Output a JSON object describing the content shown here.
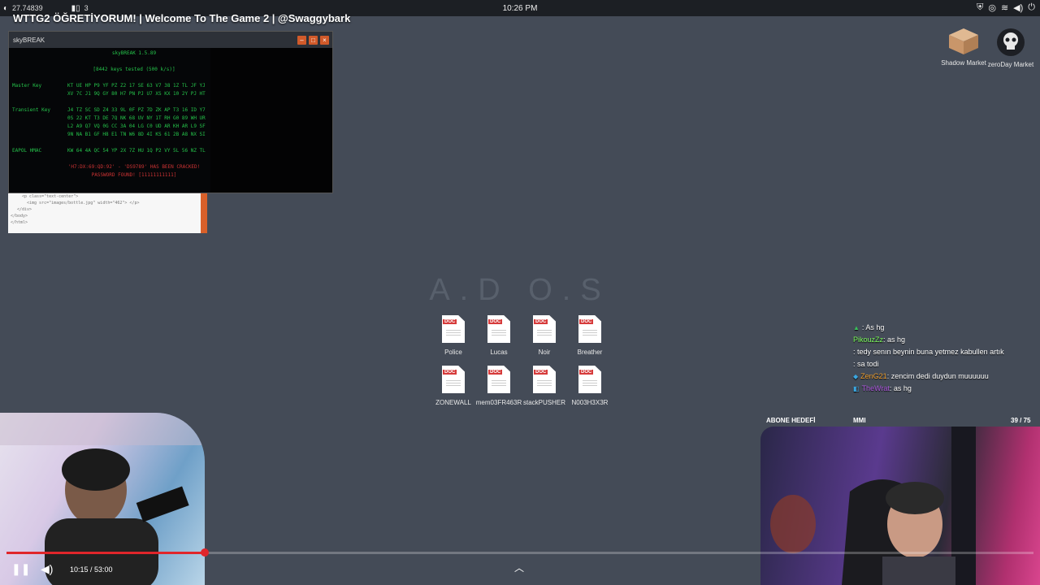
{
  "taskbar": {
    "balance": "27.74839",
    "notes_count": "3",
    "clock": "10:26 PM"
  },
  "stream_title": "WTTG2 ÖĞRETİYORUM! | Welcome To The Game 2 | @Swaggybark",
  "skybreak": {
    "window_title": "skyBREAK",
    "header": "skyBREAK 1.5.89",
    "keys_tested": "[8442 keys tested (500 k/s)]",
    "master_key_label": "Master Key",
    "master_key_lines": [
      "KT UE HP P9 YF PZ Z2 17 SE 63 V7 38 1Z TL JF YJ",
      "XV 7C J1 9Q GY 80 H7 PN PJ U7 XS KX 10 2Y PJ HT"
    ],
    "transient_key_label": "Transient Key",
    "transient_key_lines": [
      "J4 TZ SC SD Z4 33 9L 0F PZ 7D ZK AP T3 16 ID Y7",
      "0S 22 KT T3 DE 7Q NK 68 UV NY 1T RH G0 89 WH UR",
      "L2 A9 Q7 VQ 0G CC 3A 04 LG C0 UD AR KH AR L9 SF",
      "9N NA B1 GF H8 E1 TN W6 8D 4I KS 61 2B A8 NX SI"
    ],
    "eapol_label": "EAPOL HMAC",
    "eapol_line": "KW 64 4A QC 54 YP 2X 7Z HU 1Q P2 VY 5L 56 NZ TL",
    "cracked_line": "'H7:DX:69:QD:92' - 'DS9789' HAS BEEN CRACKED!",
    "password_line": "PASSWORD FOUND! [11111111111]"
  },
  "editor_lines": [
    "<p class=\"text-center\">",
    "  <img src=\"images/bottle.jpg\" width=\"462\"> </p>",
    "</div>",
    "</body>",
    "",
    "</html>"
  ],
  "desktop": {
    "title": "A.D O.S",
    "docs": [
      {
        "tag": "DOC",
        "label": "Police"
      },
      {
        "tag": "DOC",
        "label": "Lucas"
      },
      {
        "tag": "DOC",
        "label": "Noir"
      },
      {
        "tag": "DOC",
        "label": "Breather"
      },
      {
        "tag": "DOC",
        "label": "ZONEWALL"
      },
      {
        "tag": "DOC",
        "label": "mem03FR463R"
      },
      {
        "tag": "DOC",
        "label": "stackPUSHER"
      },
      {
        "tag": "DOC",
        "label": "N003H3X3R"
      }
    ]
  },
  "markets": [
    {
      "label": "Shadow Market",
      "icon": "box-icon"
    },
    {
      "label": "zeroDay Market",
      "icon": "skull-icon"
    }
  ],
  "chat": [
    {
      "user": "",
      "user_color": "#d03b3b",
      "text": ": As hg",
      "badge": "▲",
      "badge_color": "#3bbf5a"
    },
    {
      "user": "PikouzZz",
      "user_color": "#7cfc5b",
      "text": ": as hg",
      "badge": "",
      "badge_color": ""
    },
    {
      "user": "",
      "user_color": "#3b7de0",
      "text": ": tedy senın beynin buna yetmez kabullen artık",
      "badge": "",
      "badge_color": ""
    },
    {
      "user": "",
      "user_color": "#c0304a",
      "text": ": sa todi",
      "badge": "",
      "badge_color": ""
    },
    {
      "user": "ZenG21",
      "user_color": "#f0a030",
      "text": ": zencim dedi duydun muuuuuu",
      "badge": "◆",
      "badge_color": "#3aa6e0"
    },
    {
      "user": "TheWrat",
      "user_color": "#b05ce0",
      "text": ": as hg",
      "badge": "◧",
      "badge_color": "#3aa6e0"
    }
  ],
  "abone": {
    "label": "ABONE HEDEFİ",
    "middle": "MMI",
    "count": "39 / 75"
  },
  "player": {
    "time": "10:15 / 53:00",
    "progress": 0.193
  },
  "colors": {
    "desktop_bg": "#444b57",
    "terminal_green": "#25c24a",
    "progress_red": "#e0262b"
  }
}
